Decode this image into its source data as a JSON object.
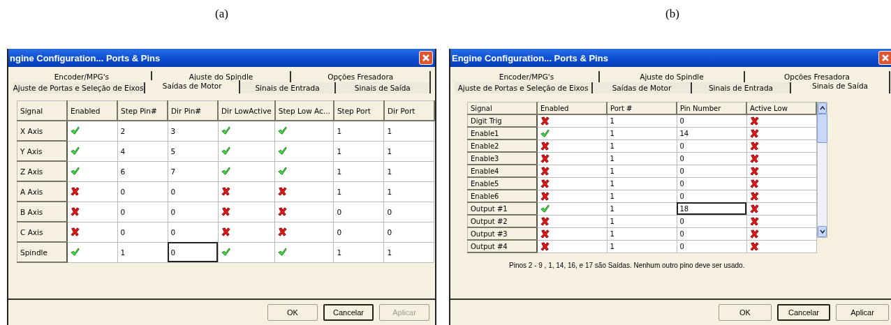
{
  "panels": [
    {
      "label": "(a)",
      "window": {
        "title": "ngine Configuration... Ports & Pins"
      },
      "tabs": {
        "back": [
          {
            "label": "Encoder/MPG's",
            "selected": false
          },
          {
            "label": "Ajuste do Spindle",
            "selected": false
          },
          {
            "label": "Opções Fresadora",
            "selected": false
          }
        ],
        "front": [
          {
            "label": "Ajuste de Portas e Seleção de Eixos",
            "selected": false
          },
          {
            "label": "Saídas de Motor",
            "selected": true
          },
          {
            "label": "Sinais de Entrada",
            "selected": false
          },
          {
            "label": "Sinais de Saída",
            "selected": false
          }
        ]
      },
      "table": {
        "columns": [
          "Signal",
          "Enabled",
          "Step Pin#",
          "Dir Pin#",
          "Dir LowActive",
          "Step Low Ac...",
          "Step Port",
          "Dir Port"
        ],
        "rows": [
          {
            "cells": [
              "X Axis",
              true,
              "2",
              "3",
              true,
              true,
              "1",
              "1"
            ]
          },
          {
            "cells": [
              "Y Axis",
              true,
              "4",
              "5",
              true,
              true,
              "1",
              "1"
            ]
          },
          {
            "cells": [
              "Z Axis",
              true,
              "6",
              "7",
              true,
              true,
              "1",
              "1"
            ]
          },
          {
            "cells": [
              "A Axis",
              false,
              "0",
              "0",
              false,
              false,
              "1",
              "1"
            ]
          },
          {
            "cells": [
              "B Axis",
              false,
              "0",
              "0",
              false,
              false,
              "0",
              "0"
            ]
          },
          {
            "cells": [
              "C Axis",
              false,
              "0",
              "0",
              false,
              false,
              "0",
              "0"
            ]
          },
          {
            "cells": [
              "Spindle",
              true,
              "1",
              {
                "text": "0",
                "focused": true
              },
              true,
              true,
              "1",
              "1"
            ]
          }
        ]
      },
      "buttons": [
        {
          "label": "OK",
          "default": false,
          "disabled": false
        },
        {
          "label": "Cancelar",
          "default": true,
          "disabled": false
        },
        {
          "label": "Aplicar",
          "default": false,
          "disabled": true
        }
      ]
    },
    {
      "label": "(b)",
      "window": {
        "title": "Engine Configuration... Ports & Pins"
      },
      "tabs": {
        "back": [
          {
            "label": "Encoder/MPG's",
            "selected": false
          },
          {
            "label": "Ajuste do Spindle",
            "selected": false
          },
          {
            "label": "Opções Fresadora",
            "selected": false
          }
        ],
        "front": [
          {
            "label": "Ajuste de Portas e Seleção de Eixos",
            "selected": false
          },
          {
            "label": "Saídas de Motor",
            "selected": false
          },
          {
            "label": "Sinais de Entrada",
            "selected": false
          },
          {
            "label": "Sinais de Saída",
            "selected": true
          }
        ]
      },
      "table": {
        "columns": [
          "Signal",
          "Enabled",
          "Port #",
          "Pin Number",
          "Active Low"
        ],
        "rows": [
          {
            "cells": [
              "Digit  Trig",
              false,
              "1",
              "0",
              false
            ]
          },
          {
            "cells": [
              "Enable1",
              true,
              "1",
              "14",
              false
            ]
          },
          {
            "cells": [
              "Enable2",
              false,
              "1",
              "0",
              false
            ]
          },
          {
            "cells": [
              "Enable3",
              false,
              "1",
              "0",
              false
            ]
          },
          {
            "cells": [
              "Enable4",
              false,
              "1",
              "0",
              false
            ]
          },
          {
            "cells": [
              "Enable5",
              false,
              "1",
              "0",
              false
            ]
          },
          {
            "cells": [
              "Enable6",
              false,
              "1",
              "0",
              false
            ]
          },
          {
            "cells": [
              "Output #1",
              true,
              "1",
              {
                "text": "18",
                "focused": true
              },
              false
            ]
          },
          {
            "cells": [
              "Output #2",
              false,
              "1",
              "0",
              false
            ]
          },
          {
            "cells": [
              "Output #3",
              false,
              "1",
              "0",
              false
            ]
          },
          {
            "cells": [
              "Output #4",
              false,
              "1",
              "0",
              false
            ]
          }
        ]
      },
      "note": "Pinos 2 - 9 , 1, 14, 16, e 17 são Saídas. Nenhum outro pino deve ser usado.",
      "buttons": [
        {
          "label": "OK",
          "default": false,
          "disabled": false
        },
        {
          "label": "Cancelar",
          "default": true,
          "disabled": false
        },
        {
          "label": "Aplicar",
          "default": false,
          "disabled": false
        }
      ]
    }
  ]
}
